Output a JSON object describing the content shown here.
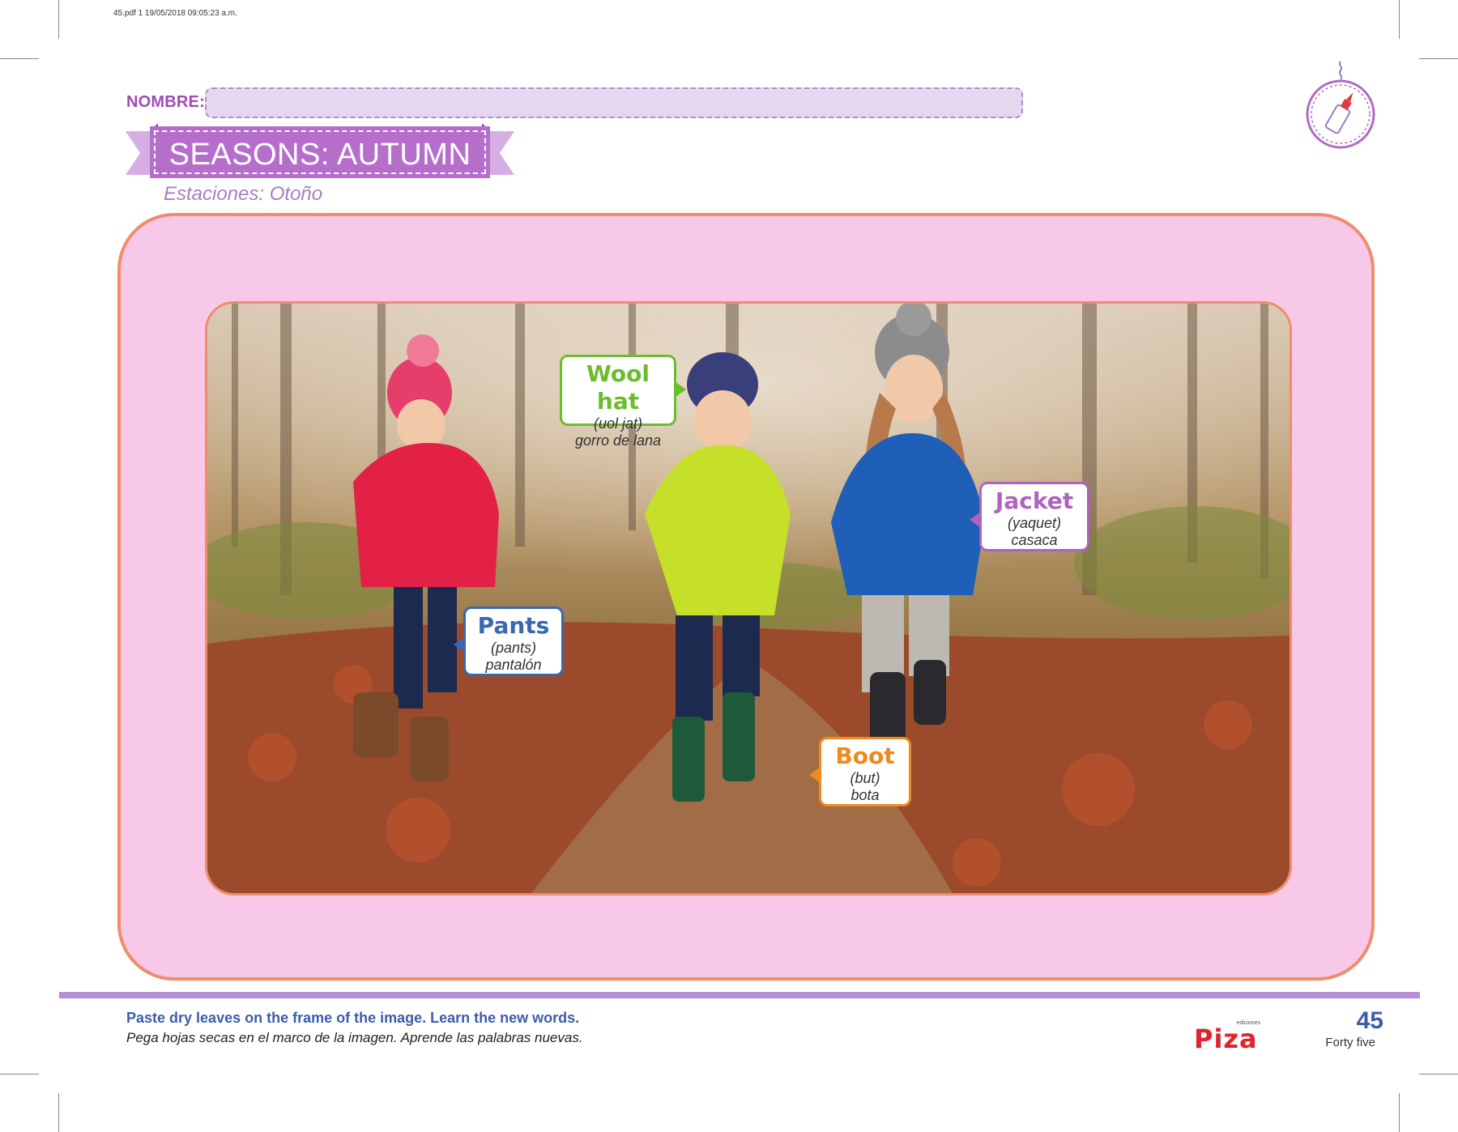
{
  "print_info": "45.pdf   1   19/05/2018   09:05:23 a.m.",
  "header": {
    "name_label": "NOMBRE:",
    "title": "SEASONS: AUTUMN",
    "subtitle": "Estaciones: Otoño",
    "glue_icon": "glue-bottle-icon"
  },
  "vocabulary": [
    {
      "word": "Wool hat",
      "pronunciation": "(uol jat)",
      "translation": "gorro de lana",
      "color": "#6cbd2e"
    },
    {
      "word": "Jacket",
      "pronunciation": "(yaquet)",
      "translation": "casaca",
      "color": "#b062c0"
    },
    {
      "word": "Pants",
      "pronunciation": "(pants)",
      "translation": "pantalón",
      "color": "#3a67b2"
    },
    {
      "word": "Boot",
      "pronunciation": "(but)",
      "translation": "bota",
      "color": "#ee8a1e"
    }
  ],
  "footer": {
    "instruction_en": "Paste dry leaves on the frame of the image. Learn the new words.",
    "instruction_es": "Pega hojas secas en el marco de la imagen. Aprende las palabras nuevas.",
    "publisher_small": "ediciones",
    "publisher": "Piza",
    "page_number": "45",
    "page_words": "Forty five"
  },
  "colors": {
    "accent_purple": "#b56fcb",
    "frame_pink": "#f8c8e8",
    "frame_border": "#ef8d6b",
    "text_blue": "#3c5ea9"
  }
}
